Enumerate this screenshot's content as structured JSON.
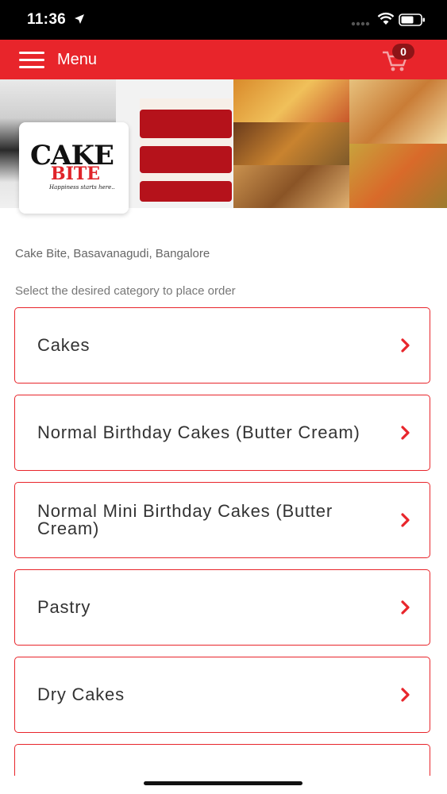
{
  "status_bar": {
    "time": "11:36"
  },
  "header": {
    "menu_label": "Menu",
    "cart_count": "0"
  },
  "brand": {
    "logo_top": "CAKE",
    "logo_bottom": "BITE",
    "tagline": "Happiness starts here.."
  },
  "store": {
    "name": "Cake Bite, Basavanagudi, Bangalore"
  },
  "instruction": "Select the desired category to place order",
  "categories": [
    {
      "label": "Cakes"
    },
    {
      "label": "Normal Birthday Cakes (Butter Cream)"
    },
    {
      "label": "Normal Mini Birthday Cakes (Butter Cream)"
    },
    {
      "label": "Pastry"
    },
    {
      "label": "Dry Cakes"
    }
  ],
  "colors": {
    "accent": "#e8252b",
    "badge": "#8e1417",
    "text": "#333333"
  },
  "icons": [
    "location-arrow-icon",
    "signal-icon",
    "wifi-icon",
    "battery-icon",
    "hamburger-menu-icon",
    "cart-icon",
    "chevron-right-icon"
  ]
}
